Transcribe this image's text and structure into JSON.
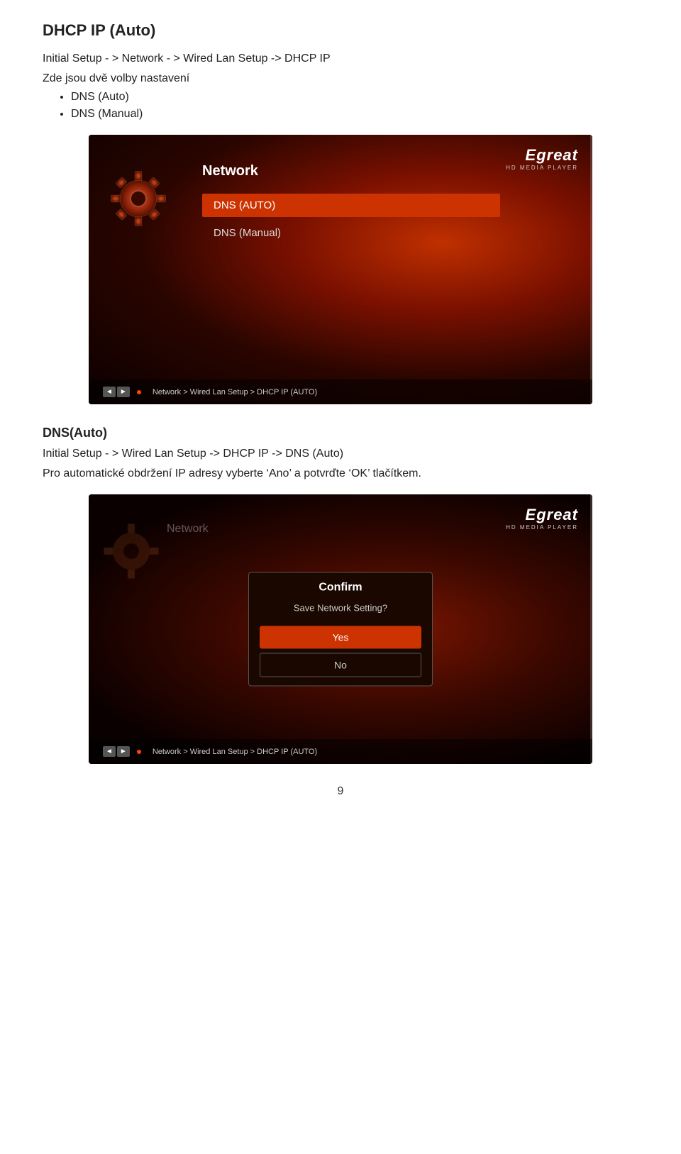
{
  "page": {
    "title": "DHCP IP (Auto)",
    "breadcrumb1": "Initial Setup - > Network - > Wired Lan Setup -> DHCP IP",
    "description": "Zde jsou dvě volby nastavení",
    "options": [
      "DNS (Auto)",
      "DNS (Manual)"
    ],
    "section2_heading": "DNS(Auto)",
    "section2_breadcrumb": "Initial Setup - > Wired Lan Setup -> DHCP IP -> DNS (Auto)",
    "section2_description": "Pro automatické obdržení IP adresy vyberte ‘Ano’ a potvrďte ‘OK’ tlačítkem.",
    "page_number": "9"
  },
  "screen1": {
    "logo": "Egreat",
    "logo_sub": "HD MEDIA PLAYER",
    "menu_title": "Network",
    "menu_items": [
      {
        "label": "DNS (AUTO)",
        "active": true
      },
      {
        "label": "DNS (Manual)",
        "active": false
      }
    ],
    "nav_path": "Network > Wired Lan Setup > DHCP IP (AUTO)"
  },
  "screen2": {
    "logo": "Egreat",
    "logo_sub": "HD MEDIA PLAYER",
    "menu_title": "Network",
    "confirm_title": "Confirm",
    "confirm_message": "Save Network Setting?",
    "btn_yes": "Yes",
    "btn_no": "No",
    "nav_path": "Network > Wired Lan Setup > DHCP IP (AUTO)"
  }
}
